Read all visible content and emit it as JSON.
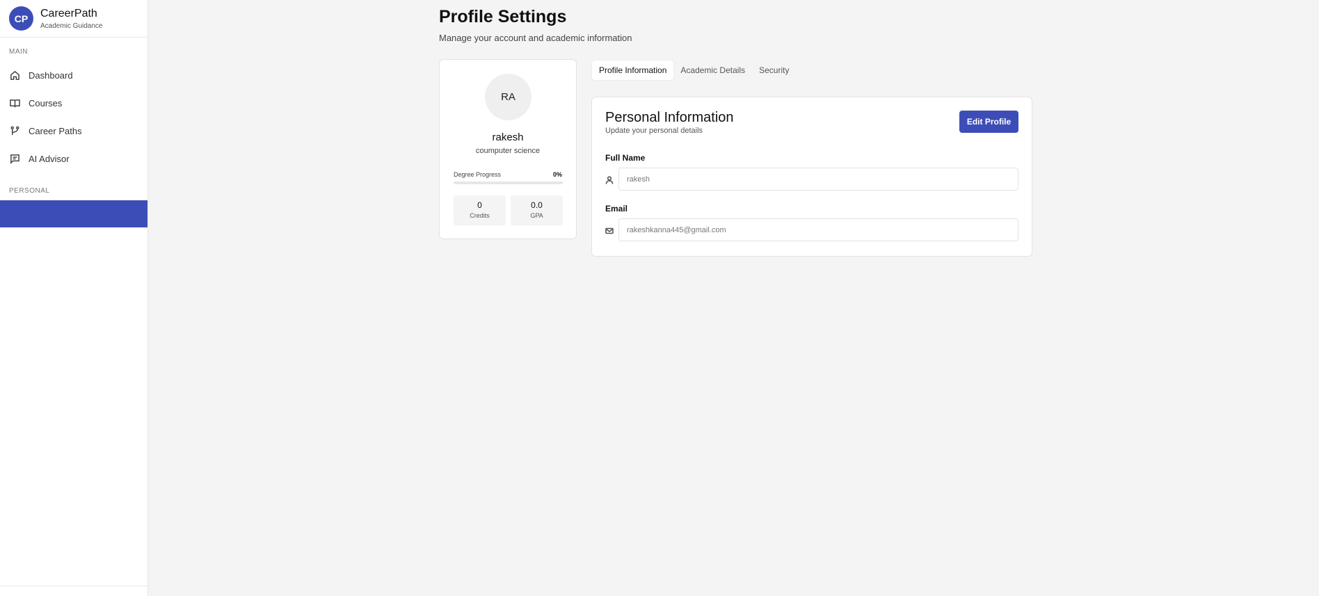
{
  "brand": {
    "logo": "CP",
    "name": "CareerPath",
    "subtitle": "Academic Guidance"
  },
  "sidebar": {
    "main_label": "MAIN",
    "items": [
      {
        "label": "Dashboard",
        "icon": "home-icon"
      },
      {
        "label": "Courses",
        "icon": "book-icon"
      },
      {
        "label": "Career Paths",
        "icon": "branch-icon"
      },
      {
        "label": "AI Advisor",
        "icon": "chat-icon"
      }
    ],
    "personal_label": "PERSONAL",
    "accent": "#3d4db7"
  },
  "header": {
    "title": "Profile Settings",
    "subtitle": "Manage your account and academic information"
  },
  "profile": {
    "initials": "RA",
    "name": "rakesh",
    "major": "coumputer science",
    "progress_label": "Degree Progress",
    "progress_value": "0%",
    "progress_fraction": 0,
    "credits_value": "0",
    "credits_label": "Credits",
    "gpa_value": "0.0",
    "gpa_label": "GPA"
  },
  "tabs": [
    {
      "label": "Profile Information",
      "active": true
    },
    {
      "label": "Academic Details",
      "active": false
    },
    {
      "label": "Security",
      "active": false
    }
  ],
  "personal_info": {
    "title": "Personal Information",
    "subtitle": "Update your personal details",
    "edit_label": "Edit Profile",
    "full_name_label": "Full Name",
    "full_name_value": "rakesh",
    "email_label": "Email",
    "email_value": "rakeshkanna445@gmail.com"
  }
}
